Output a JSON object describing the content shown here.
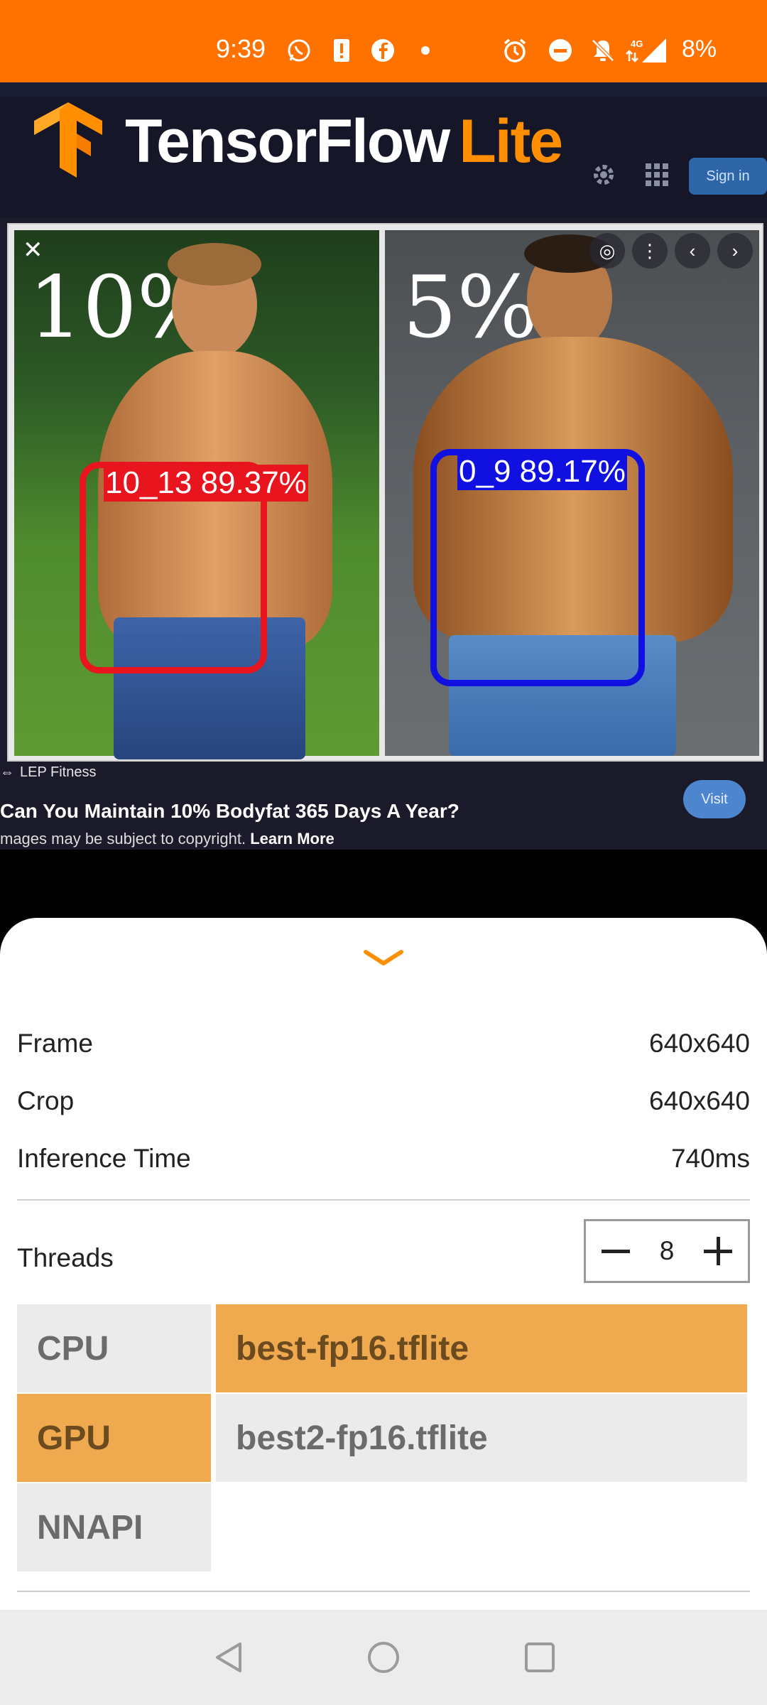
{
  "status_bar": {
    "time": "9:39",
    "battery_percent": "8%",
    "network": "4G",
    "accent_color": "#FF7200"
  },
  "header": {
    "logo_icon": "tensorflow-logo-icon",
    "title_main": "TensorFlow",
    "title_suffix": "Lite"
  },
  "camera_preview": {
    "browser_button": "Sign in",
    "photo_left_label": "10%",
    "photo_right_label": "5%",
    "caption_source": "LEP Fitness",
    "caption_title": "Can You Maintain 10% Bodyfat 365 Days A Year?",
    "caption_copyright": "mages may be subject to copyright.",
    "caption_learn_more": "Learn More",
    "visit_button": "Visit"
  },
  "detections": [
    {
      "label": "10_13 89.37%",
      "color": "#E8141E"
    },
    {
      "label": "0_9 89.17%",
      "color": "#1010E0"
    }
  ],
  "bottom_sheet": {
    "chevron_icon": "chevron-down-icon",
    "frame_label": "Frame",
    "frame_value": "640x640",
    "crop_label": "Crop",
    "crop_value": "640x640",
    "inference_label": "Inference Time",
    "inference_value": "740ms",
    "threads_label": "Threads",
    "threads_value": "8",
    "delegates": [
      "CPU",
      "GPU",
      "NNAPI"
    ],
    "selected_delegate": "GPU",
    "models": [
      "best-fp16.tflite",
      "best2-fp16.tflite"
    ],
    "selected_model": "best-fp16.tflite",
    "selected_color": "#EFA94F"
  },
  "nav_bar": {
    "back_icon": "back-icon",
    "home_icon": "home-icon",
    "recents_icon": "recents-icon"
  }
}
